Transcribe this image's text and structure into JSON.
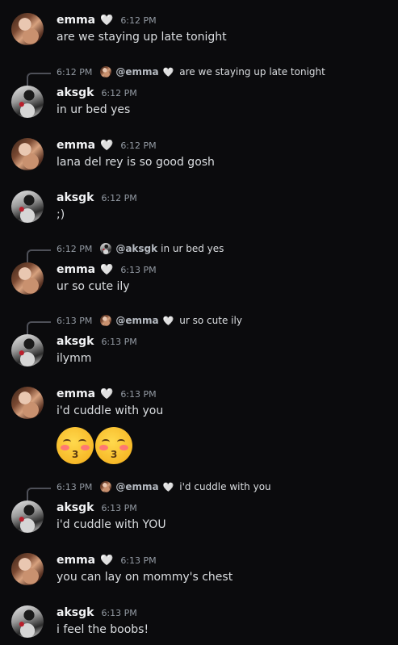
{
  "users": {
    "emma": {
      "name": "emma",
      "badge": "🤍"
    },
    "aksgk": {
      "name": "aksgk"
    }
  },
  "colors": {
    "background": "#0b0b0d",
    "username": "#f2f3f5",
    "timestamp": "#949ba4",
    "heart": "#d4bdf5"
  },
  "messages": [
    {
      "author": "emma",
      "badge": "🤍",
      "time": "6:12 PM",
      "text": "are we staying up late tonight"
    },
    {
      "author": "aksgk",
      "time": "6:12 PM",
      "text": "in ur bed yes",
      "reply": {
        "time": "6:12 PM",
        "name": "@emma",
        "badge": "🤍",
        "text": "are we staying up late tonight"
      }
    },
    {
      "author": "emma",
      "badge": "🤍",
      "time": "6:12 PM",
      "text": "lana del rey is so good gosh"
    },
    {
      "author": "aksgk",
      "time": "6:12 PM",
      "text": ";)"
    },
    {
      "author": "emma",
      "badge": "🤍",
      "time": "6:13 PM",
      "text": "ur so cute ily",
      "reply": {
        "time": "6:12 PM",
        "name": "@aksgk",
        "text": "in ur bed yes"
      }
    },
    {
      "author": "aksgk",
      "time": "6:13 PM",
      "text": "ilymm",
      "reply": {
        "time": "6:13 PM",
        "name": "@emma",
        "badge": "🤍",
        "text": "ur so cute ily"
      }
    },
    {
      "author": "emma",
      "badge": "🤍",
      "time": "6:13 PM",
      "text": "i'd cuddle with you",
      "emoji": [
        "kissing-face-with-closed-eyes",
        "kissing-face-with-closed-eyes"
      ]
    },
    {
      "author": "aksgk",
      "time": "6:13 PM",
      "text": "i'd cuddle with YOU",
      "reply": {
        "time": "6:13 PM",
        "name": "@emma",
        "badge": "🤍",
        "text": "i'd cuddle with you"
      }
    },
    {
      "author": "emma",
      "badge": "🤍",
      "time": "6:13 PM",
      "text": "you can lay on mommy's chest"
    },
    {
      "author": "aksgk",
      "time": "6:13 PM",
      "text": "i feel the boobs!"
    }
  ]
}
